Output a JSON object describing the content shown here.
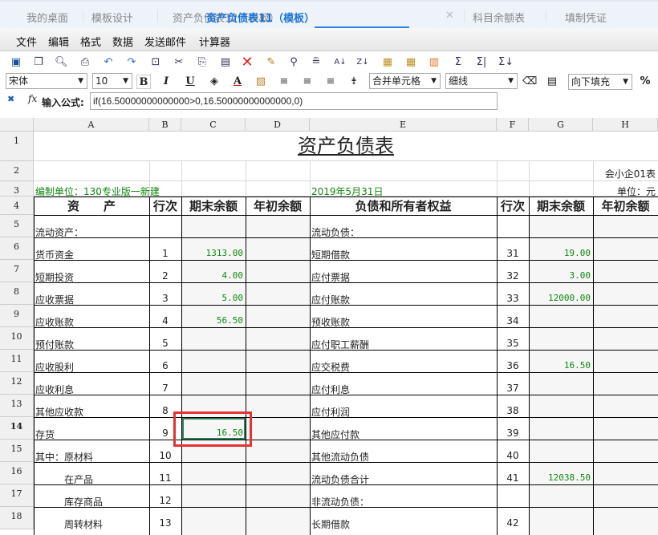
{
  "tabs": [
    {
      "label": "我的桌面"
    },
    {
      "label": "模板设计"
    },
    {
      "label": "资产负债表12（模板）"
    },
    {
      "label": "资产负债表11（模板）",
      "active": true
    },
    {
      "label": "科目余额表"
    },
    {
      "label": "填制凭证"
    }
  ],
  "tab_close": "✕",
  "menu": [
    "文件",
    "编辑",
    "格式",
    "数据",
    "发送邮件",
    "计算器"
  ],
  "toolbar_icons": [
    "save-icon",
    "save-as-icon",
    "print-preview-icon",
    "print-icon",
    "undo-icon",
    "redo-icon",
    "select-icon",
    "cut-icon",
    "copy-icon",
    "paste-icon",
    "delete-icon",
    "brush-icon",
    "find-icon",
    "replace-icon",
    "sort-asc-icon",
    "sort-desc-icon",
    "paste-special-icon",
    "paste-values-icon",
    "column-icon",
    "sum-icon",
    "sum-row-icon",
    "sum-col-icon"
  ],
  "format": {
    "font": "宋体",
    "size": "10",
    "bold": "B",
    "italic": "I",
    "underline": "U",
    "font_color": "A",
    "merge": "合并单元格",
    "border": "细线",
    "fill": "向下填充",
    "percent": "%"
  },
  "formula": {
    "label": "输入公式:",
    "fx": "fx",
    "value": "if(16.50000000000000>0,16.50000000000000,0)"
  },
  "columns": [
    "A",
    "B",
    "C",
    "D",
    "E",
    "F",
    "G",
    "H"
  ],
  "sheet": {
    "title": "资产负债表",
    "form_no": "会小企01表",
    "company": "编制单位：130专业版一新建",
    "date": "2019年5月31日",
    "unit": "单位：元",
    "headers": [
      "资　　产",
      "行次",
      "期末余额",
      "年初余额",
      "负债和所有者权益",
      "行次",
      "期末余额",
      "年初余额"
    ],
    "rows": [
      {
        "n": "5",
        "a": "流动资产：",
        "b": "",
        "c": "",
        "e": "流动负债：",
        "f": "",
        "g": ""
      },
      {
        "n": "6",
        "a": "货币资金",
        "b": "1",
        "c": "1313.00",
        "e": "短期借款",
        "f": "31",
        "g": "19.00"
      },
      {
        "n": "7",
        "a": "短期投资",
        "b": "2",
        "c": "4.00",
        "e": "应付票据",
        "f": "32",
        "g": "3.00"
      },
      {
        "n": "8",
        "a": "应收票据",
        "b": "3",
        "c": "5.00",
        "e": "应付账款",
        "f": "33",
        "g": "12000.00"
      },
      {
        "n": "9",
        "a": "应收账款",
        "b": "4",
        "c": "56.50",
        "e": "预收账款",
        "f": "34",
        "g": ""
      },
      {
        "n": "10",
        "a": "预付账款",
        "b": "5",
        "c": "",
        "e": "应付职工薪酬",
        "f": "35",
        "g": ""
      },
      {
        "n": "11",
        "a": "应收股利",
        "b": "6",
        "c": "",
        "e": "应交税费",
        "f": "36",
        "g": "16.50"
      },
      {
        "n": "12",
        "a": "应收利息",
        "b": "7",
        "c": "",
        "e": "应付利息",
        "f": "37",
        "g": ""
      },
      {
        "n": "13",
        "a": "其他应收款",
        "b": "8",
        "c": "",
        "e": "应付利润",
        "f": "38",
        "g": ""
      },
      {
        "n": "14",
        "a": "存货",
        "b": "9",
        "c": "16.50",
        "e": "其他应付款",
        "f": "39",
        "g": ""
      },
      {
        "n": "15",
        "a": "其中：原材料",
        "b": "10",
        "c": "",
        "e": "其他流动负债",
        "f": "40",
        "g": ""
      },
      {
        "n": "16",
        "a": "　　　在产品",
        "b": "11",
        "c": "",
        "e": "流动负债合计",
        "f": "41",
        "g": "12038.50"
      },
      {
        "n": "17",
        "a": "　　　库存商品",
        "b": "12",
        "c": "",
        "e": "非流动负债：",
        "f": "",
        "g": ""
      },
      {
        "n": "18",
        "a": "　　　周转材料",
        "b": "13",
        "c": "",
        "e": "长期借款",
        "f": "42",
        "g": ""
      }
    ]
  },
  "selected_cell": "C14",
  "colors": {
    "accent": "#2c82e0",
    "value_green": "#118811",
    "selection_red": "#e53333"
  }
}
